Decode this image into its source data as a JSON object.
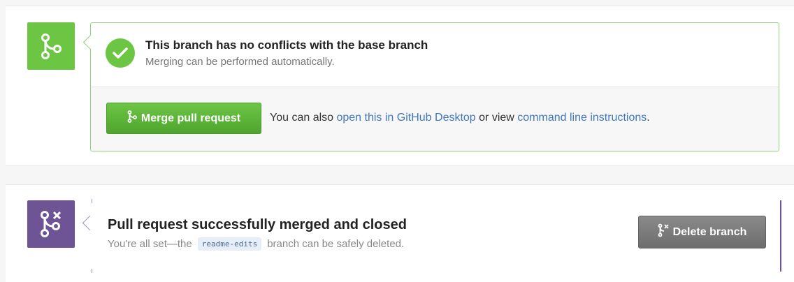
{
  "merge_section": {
    "state_icon": "git-merge-icon",
    "status_icon": "check-icon",
    "title": "This branch has no conflicts with the base branch",
    "subtitle": "Merging can be performed automatically.",
    "merge_button_label": "Merge pull request",
    "merge_button_icon": "git-merge-icon",
    "hint_prefix": "You can also ",
    "hint_link_desktop": "open this in GitHub Desktop",
    "hint_middle": " or view ",
    "hint_link_cli": "command line instructions",
    "hint_suffix": "."
  },
  "merged_section": {
    "state_icon": "git-pull-request-closed-icon",
    "title": "Pull request successfully merged and closed",
    "subtitle_prefix": "You're all set—the",
    "branch_name": "readme-edits",
    "subtitle_suffix": "branch can be safely deleted.",
    "delete_button_label": "Delete branch",
    "delete_button_icon": "git-branch-delete-icon"
  },
  "colors": {
    "success_green": "#6cc644",
    "merged_purple": "#6e5494",
    "link_blue": "#4078c0",
    "delete_gray": "#7a7a7a"
  }
}
